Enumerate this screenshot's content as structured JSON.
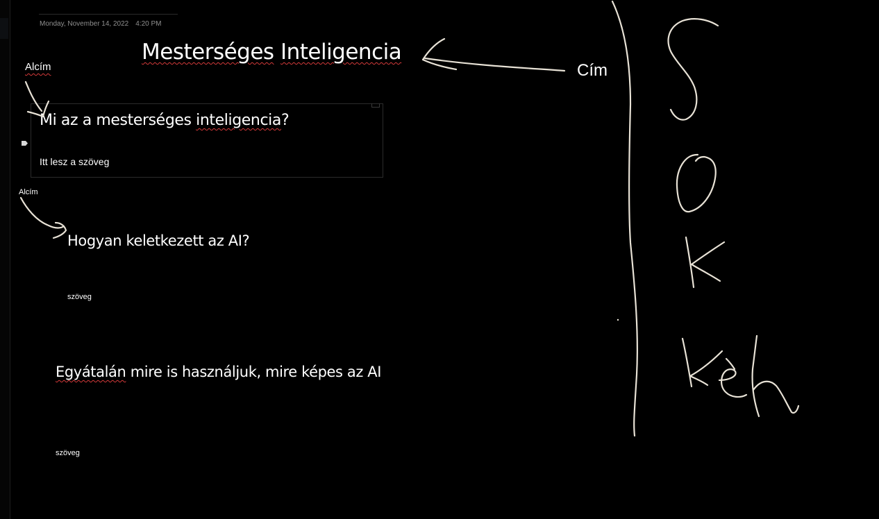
{
  "page": {
    "date": "Monday, November 14, 2022",
    "time": "4:20 PM",
    "title_words": [
      "Mesterséges",
      "Inteligencia"
    ]
  },
  "annotations": {
    "subtitle_label_1": "Alcím",
    "subtitle_label_2": "Alcím",
    "title_label": "Cím"
  },
  "sections": [
    {
      "heading_parts": [
        "Mi az a mesterséges ",
        "inteligencia",
        "?"
      ],
      "text": "Itt lesz a szöveg"
    },
    {
      "heading": "Hogyan keletkezett az AI?",
      "text": "szöveg"
    },
    {
      "heading_parts": [
        "Egyátalán",
        " mire is használjuk, mire képes az AI"
      ],
      "text": "szöveg"
    }
  ],
  "ink": {
    "color": "#e8e2d6",
    "handwriting": "SOK Kép"
  },
  "colors": {
    "background": "#000000",
    "text": "#ffffff",
    "date_text": "#8f8f8f",
    "spellcheck_underline": "#d43a3a"
  }
}
